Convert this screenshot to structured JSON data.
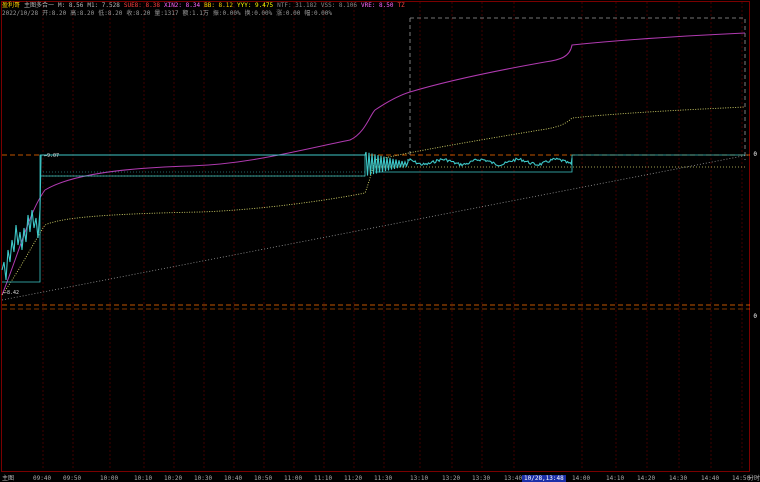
{
  "header": {
    "line1": [
      {
        "text": "盈利哥",
        "color": "#ffd200"
      },
      {
        "text": "主图多合一",
        "color": "#bbbbbb"
      },
      {
        "text": "M: 8.56",
        "color": "#bbbbbb"
      },
      {
        "text": "M1: 7.528",
        "color": "#bbbbbb"
      },
      {
        "text": "SUE8: 8.38",
        "color": "#ff4040"
      },
      {
        "text": "XIN2: 8.34",
        "color": "#ff66ff"
      },
      {
        "text": "BB: 8.12",
        "color": "#ffd200"
      },
      {
        "text": "YYY: 9.475",
        "color": "#ffff00"
      },
      {
        "text": "NTF: 31.182",
        "color": "#888888"
      },
      {
        "text": "VSS: 8.106",
        "color": "#888888"
      },
      {
        "text": "VRE: 8.50",
        "color": "#ff66ff"
      },
      {
        "text": "TZ",
        "color": "#ff4040"
      }
    ],
    "line2": [
      "2022/10/28",
      "开:8.20",
      "高:8.20",
      "低:8.20",
      "收:8.20",
      "量:1317",
      "额:1.1万",
      "振:0.00%",
      "换:0.00%",
      "涨:0.00",
      "幅:0.00%"
    ]
  },
  "colors": {
    "background": "#000000",
    "grid": "#5a0000",
    "frame": "#7a0000",
    "price_line": "#3ec8c8",
    "purple_line": "#b03ab0",
    "yellow_line": "#d6d66a",
    "dashed_gray": "#9a9a9a",
    "orange_dash": "#ff7000"
  },
  "price_labels": {
    "high": "9.07",
    "low": "8.42"
  },
  "right_marker": "0",
  "right_marker2": "0",
  "time_axis": {
    "left_label": "主图",
    "ticks": [
      "09:40",
      "09:50",
      "10:00",
      "10:10",
      "10:20",
      "10:30",
      "10:40",
      "10:50",
      "11:00",
      "11:10",
      "11:20",
      "11:30",
      "13:10",
      "13:20",
      "13:30",
      "13:40",
      "10/28,13:48",
      "14:00",
      "14:10",
      "14:20",
      "14:30",
      "14:40",
      "14:50"
    ],
    "right_label": "分时"
  }
}
